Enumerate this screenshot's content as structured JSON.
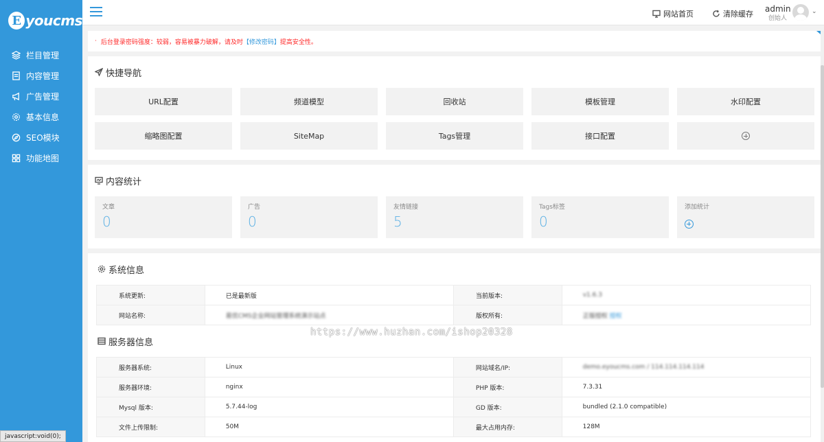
{
  "brand": {
    "badge": "E",
    "name": "youcms"
  },
  "sidebar": {
    "items": [
      {
        "label": "栏目管理",
        "icon": "layers-icon"
      },
      {
        "label": "内容管理",
        "icon": "document-icon"
      },
      {
        "label": "广告管理",
        "icon": "megaphone-icon"
      },
      {
        "label": "基本信息",
        "icon": "gear-icon"
      },
      {
        "label": "SEO模块",
        "icon": "compass-icon"
      },
      {
        "label": "功能地图",
        "icon": "grid-icon"
      }
    ]
  },
  "topbar": {
    "site_home": "网站首页",
    "clear_cache": "清除缓存",
    "user": {
      "name": "admin",
      "role": "创始人"
    }
  },
  "notice": {
    "dot": "·",
    "text": "后台登录密码强度：较弱，容易被暴力破解，请及时",
    "link": "【修改密码】",
    "suffix": "提高安全性。"
  },
  "quick_nav": {
    "title": "快捷导航",
    "items": [
      "URL配置",
      "频道模型",
      "回收站",
      "模板管理",
      "水印配置",
      "缩略图配置",
      "SiteMap",
      "Tags管理",
      "接口配置"
    ]
  },
  "content_stats": {
    "title": "内容统计",
    "items": [
      {
        "label": "文章",
        "value": "0"
      },
      {
        "label": "广告",
        "value": "0"
      },
      {
        "label": "友情链接",
        "value": "5"
      },
      {
        "label": "Tags标签",
        "value": "0"
      }
    ],
    "add_label": "添加统计"
  },
  "system_info": {
    "title": "系统信息",
    "rows": [
      {
        "l1": "系统更新:",
        "v1": "已是最新版",
        "l2": "当前版本:",
        "v2": "v1.6.3"
      },
      {
        "l1": "网站名称:",
        "v1": "易优CMS企业网站管理系统演示站点",
        "l2": "版权所有:",
        "v2": "正版授权",
        "v2_link": "授权"
      }
    ]
  },
  "server_info": {
    "title": "服务器信息",
    "rows": [
      {
        "l1": "服务器系统:",
        "v1": "Linux",
        "l2": "网站域名/IP:",
        "v2": "demo.eyoucms.com / 114.114.114.114"
      },
      {
        "l1": "服务器环境:",
        "v1": "nginx",
        "l2": "PHP 版本:",
        "v2": "7.3.31"
      },
      {
        "l1": "Mysql 版本:",
        "v1": "5.7.44-log",
        "l2": "GD 版本:",
        "v2": "bundled (2.1.0 compatible)"
      },
      {
        "l1": "文件上传限制:",
        "v1": "50M",
        "l2": "最大占用内存:",
        "v2": "128M"
      }
    ]
  },
  "watermark": "https://www.huzhan.com/ishop20328",
  "status_bar": "javascript:void(0);"
}
